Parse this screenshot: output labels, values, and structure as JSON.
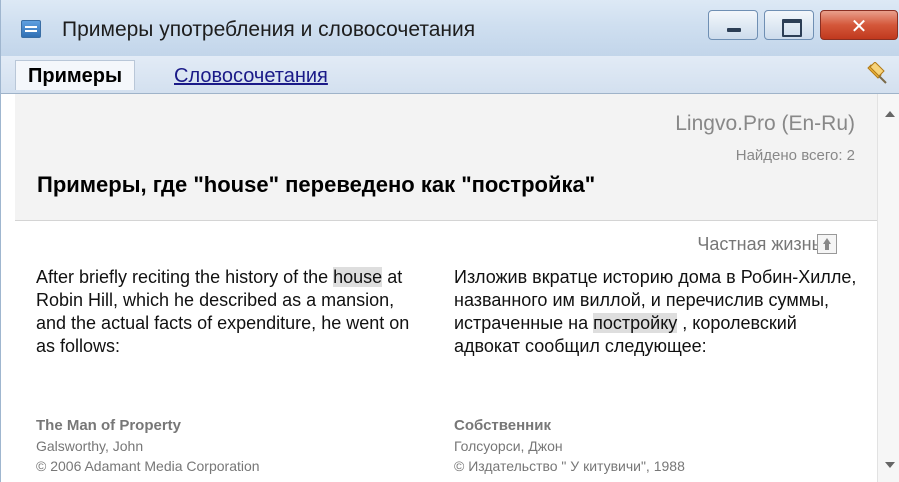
{
  "window": {
    "title": "Примеры употребления и словосочетания",
    "icon": "dictionary-window-icon",
    "close_label": "✕"
  },
  "tabs": [
    {
      "label": "Примеры",
      "active": true
    },
    {
      "label": "Словосочетания",
      "active": false
    }
  ],
  "header": {
    "dictionary": "Lingvo.Pro (En-Ru)",
    "found_total": "Найдено всего: 2",
    "heading": "Примеры, где \"house\" переведено как \"постройка\""
  },
  "example": {
    "source_title": "Частная жизнь",
    "en": {
      "before": "After briefly reciting the history of the ",
      "highlight": "house",
      "after": " at Robin Hill, which he described as a mansion, and the actual facts of expenditure, he went on as follows:",
      "book": "The Man of Property",
      "author": "Galsworthy, John",
      "publisher": "© 2006 Adamant Media Corporation"
    },
    "ru": {
      "before": "Изложив вкратце историю дома в Робин-Хилле, названного им виллой, и перечислив суммы, истраченные на ",
      "highlight": "постройку",
      "after": " , королевский адвокат сообщил следующее:",
      "book": "Собственник",
      "author": "Голсуорси, Джон",
      "publisher": "© Издательство \" У китувичи\", 1988"
    }
  },
  "colors": {
    "titlebar": "#cfdff0",
    "highlight": "#dedede",
    "link": "#1a1a88",
    "close_button": "#c0391e"
  }
}
